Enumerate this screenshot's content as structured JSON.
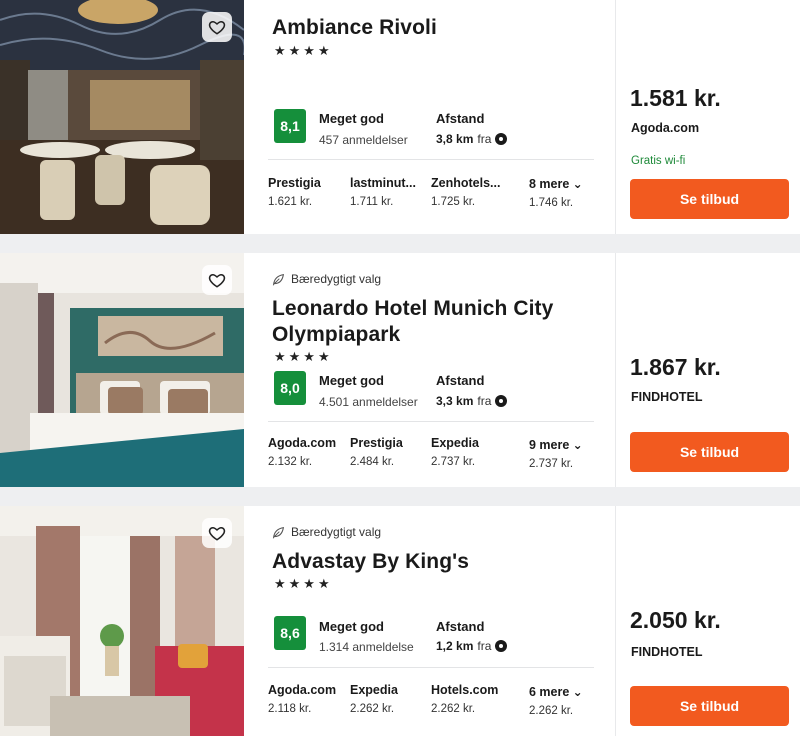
{
  "hotels": [
    {
      "eco_label": "",
      "name_line1": "Ambiance Rivoli",
      "name_line2": "",
      "stars": "★★★★",
      "score": "8,1",
      "rating_word": "Meget god",
      "reviews": "457 anmeldelser",
      "distance_label": "Afstand",
      "distance_value": "3,8 km",
      "distance_suffix": "fra",
      "providers": [
        {
          "name": "Prestigia",
          "price": "1.621 kr."
        },
        {
          "name": "lastminut...",
          "price": "1.711 kr."
        },
        {
          "name": "Zenhotels...",
          "price": "1.725 kr."
        },
        {
          "name": "8 mere",
          "price": "1.746 kr."
        }
      ],
      "price": "1.581 kr.",
      "source": "Agoda.com",
      "perk": "Gratis wi-fi",
      "cta": "Se tilbud"
    },
    {
      "eco_label": "Bæredygtigt valg",
      "name_line1": "Leonardo Hotel Munich City",
      "name_line2": "Olympiapark",
      "stars": "★★★★",
      "score": "8,0",
      "rating_word": "Meget god",
      "reviews": "4.501 anmeldelser",
      "distance_label": "Afstand",
      "distance_value": "3,3 km",
      "distance_suffix": "fra",
      "providers": [
        {
          "name": "Agoda.com",
          "price": "2.132 kr."
        },
        {
          "name": "Prestigia",
          "price": "2.484 kr."
        },
        {
          "name": "Expedia",
          "price": "2.737 kr."
        },
        {
          "name": "9 mere",
          "price": "2.737 kr."
        }
      ],
      "price": "1.867 kr.",
      "source": "FINDHOTEL",
      "perk": "",
      "cta": "Se tilbud"
    },
    {
      "eco_label": "Bæredygtigt valg",
      "name_line1": "Advastay By King's",
      "name_line2": "",
      "stars": "★★★★",
      "score": "8,6",
      "rating_word": "Meget god",
      "reviews": "1.314 anmeldelse",
      "distance_label": "Afstand",
      "distance_value": "1,2 km",
      "distance_suffix": "fra",
      "providers": [
        {
          "name": "Agoda.com",
          "price": "2.118 kr."
        },
        {
          "name": "Expedia",
          "price": "2.262 kr."
        },
        {
          "name": "Hotels.com",
          "price": "2.262 kr."
        },
        {
          "name": "6 mere",
          "price": "2.262 kr."
        }
      ],
      "price": "2.050 kr.",
      "source": "FINDHOTEL",
      "perk": "",
      "cta": "Se tilbud"
    }
  ],
  "colors": {
    "score_bg": "#158f3b",
    "cta_bg": "#f25a1f",
    "perk_text": "#1f8a3a"
  },
  "icons": {
    "favorite": "heart-icon",
    "eco": "leaf-icon",
    "location": "location-dot-icon",
    "more": "chevron-down-icon"
  }
}
